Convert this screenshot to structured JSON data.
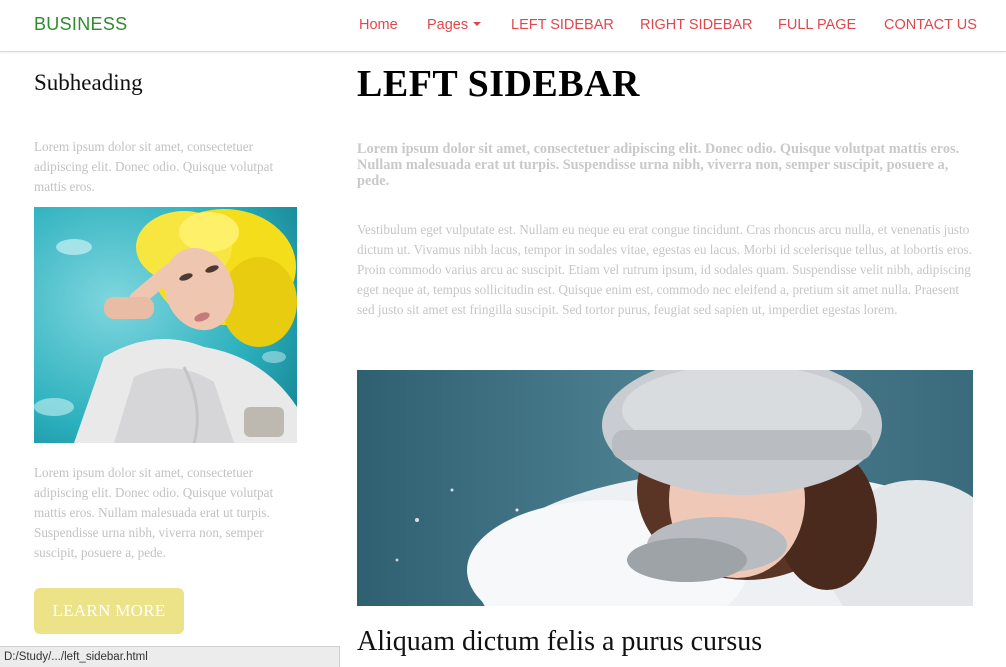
{
  "navbar": {
    "brand": "BUSINESS",
    "items": [
      {
        "label": "Home"
      },
      {
        "label": "Pages"
      },
      {
        "label": "LEFT SIDEBAR"
      },
      {
        "label": "RIGHT SIDEBAR"
      },
      {
        "label": "FULL PAGE"
      },
      {
        "label": "CONTACT US"
      }
    ],
    "link_color": "#e0474c",
    "brand_color": "#2e8b2e"
  },
  "sidebar": {
    "heading": "Subheading",
    "text1": "Lorem ipsum dolor sit amet, consectetuer adipiscing elit. Donec odio. Quisque volutpat mattis eros.",
    "image_name": "woman-yellow-curly-hair-photo",
    "text2": "Lorem ipsum dolor sit amet, consectetuer adipiscing elit. Donec odio. Quisque volutpat mattis eros. Nullam malesuada erat ut turpis. Suspendisse urna nibh, viverra non, semper suscipit, posuere a, pede.",
    "button_label": "LEARN MORE",
    "button_color": "#ece389"
  },
  "main": {
    "title": "LEFT SIDEBAR",
    "lead": "Lorem ipsum dolor sit amet, consectetuer adipiscing elit. Donec odio. Quisque volutpat mattis eros. Nullam malesuada erat ut turpis. Suspendisse urna nibh, viverra non, semper suscipit, posuere a, pede.",
    "body": "Vestibulum eget vulputate est. Nullam eu neque eu erat congue tincidunt. Cras rhoncus arcu nulla, et venenatis justo dictum ut. Vivamus nibh lacus, tempor in sodales vitae, egestas eu lacus. Morbi id scelerisque tellus, at lobortis eros. Proin commodo varius arcu ac suscipit. Etiam vel rutrum ipsum, id sodales quam. Suspendisse velit nibh, adipiscing eget neque at, tempus sollicitudin est. Quisque enim est, commodo nec eleifend a, pretium sit amet nulla. Praesent sed justo sit amet est fringilla suscipit. Sed tortor purus, feugiat sed sapien ut, imperdiet egestas lorem.",
    "image_name": "woman-winter-fur-hat-photo",
    "section_heading": "Aliquam dictum felis a purus cursus"
  },
  "status_bar": {
    "url": "D:/Study/.../left_sidebar.html"
  }
}
